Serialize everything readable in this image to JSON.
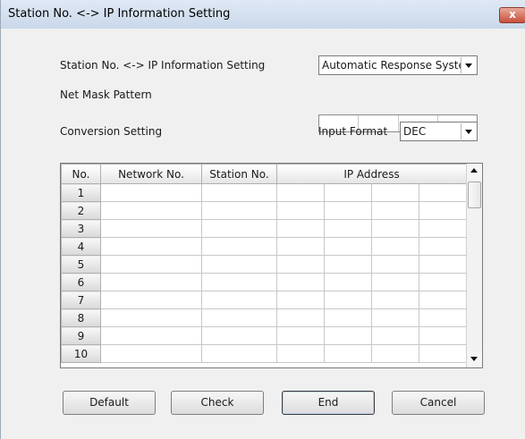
{
  "window": {
    "title": "Station No. <-> IP Information Setting",
    "close_glyph": "x"
  },
  "form": {
    "station_setting_label": "Station No. <-> IP Information Setting",
    "station_setting_value": "Automatic Response System",
    "net_mask_label": "Net Mask Pattern",
    "conversion_label": "Conversion Setting",
    "input_format_label": "Input Format",
    "input_format_value": "DEC"
  },
  "table": {
    "headers": [
      "No.",
      "Network No.",
      "Station No.",
      "IP Address"
    ],
    "rows": [
      "1",
      "2",
      "3",
      "4",
      "5",
      "6",
      "7",
      "8",
      "9",
      "10"
    ]
  },
  "buttons": {
    "default": "Default",
    "check": "Check",
    "end": "End",
    "cancel": "Cancel"
  },
  "icons": [
    "close-icon",
    "chevron-down-icon",
    "scroll-up-icon",
    "scroll-down-icon"
  ]
}
